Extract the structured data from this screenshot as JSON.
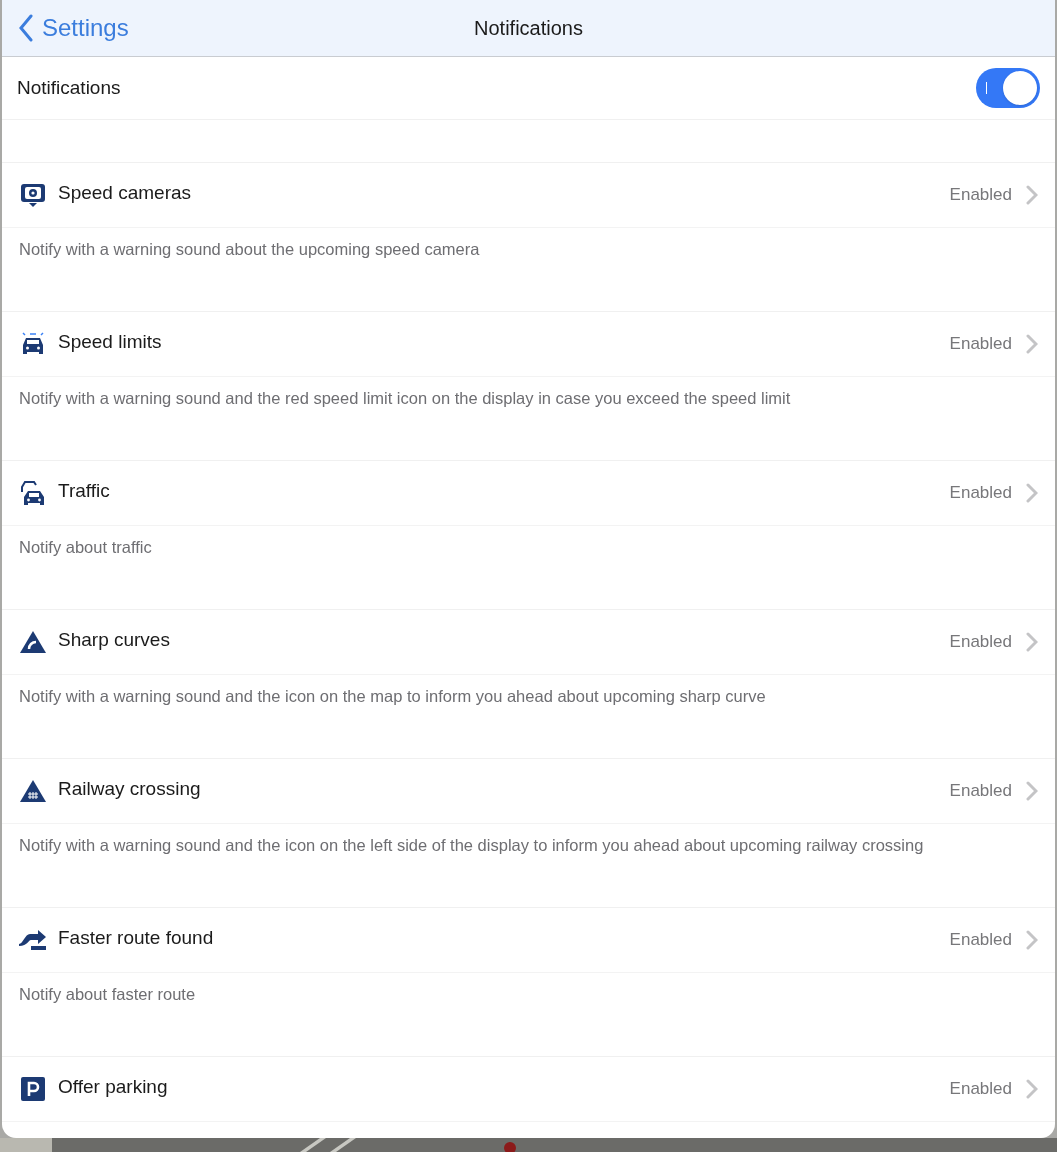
{
  "nav": {
    "back_label": "Settings",
    "title": "Notifications"
  },
  "master": {
    "label": "Notifications",
    "on": true
  },
  "items": [
    {
      "kind": "camera",
      "title": "Speed cameras",
      "status": "Enabled",
      "description": "Notify with a warning sound about the upcoming speed camera"
    },
    {
      "kind": "police",
      "title": "Speed limits",
      "status": "Enabled",
      "description": "Notify with a warning sound and the red speed limit icon on the display in case you exceed the speed limit"
    },
    {
      "kind": "traffic",
      "title": "Traffic",
      "status": "Enabled",
      "description": "Notify about traffic"
    },
    {
      "kind": "curve",
      "title": "Sharp curves",
      "status": "Enabled",
      "description": "Notify with a warning sound and the icon on the map to inform you ahead about upcoming sharp curve"
    },
    {
      "kind": "railway",
      "title": "Railway crossing",
      "status": "Enabled",
      "description": "Notify with a warning sound and the icon on the left side of the display to inform you ahead about upcoming railway crossing"
    },
    {
      "kind": "route",
      "title": "Faster route found",
      "status": "Enabled",
      "description": "Notify about faster route"
    },
    {
      "kind": "parking",
      "title": "Offer parking",
      "status": "Enabled"
    }
  ]
}
